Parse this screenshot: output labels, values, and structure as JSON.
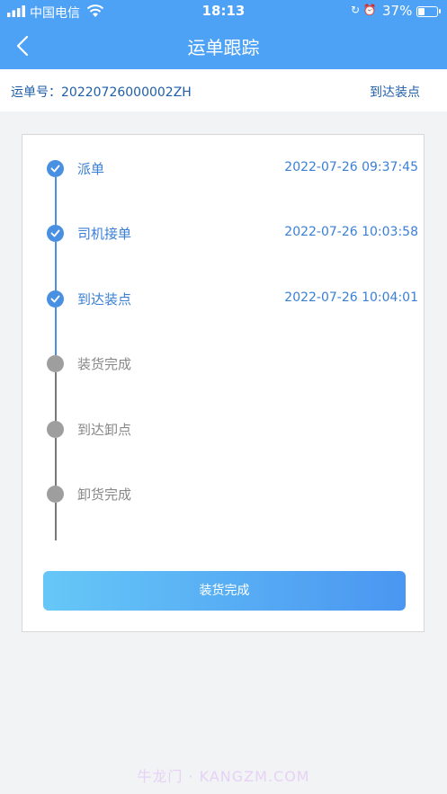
{
  "status_bar": {
    "carrier": "中国电信",
    "time": "18:13",
    "battery_pct": "37%",
    "battery_level": 0.37,
    "icons": [
      "signal-icon",
      "wifi-icon",
      "orientation-lock-icon",
      "alarm-icon",
      "battery-icon"
    ]
  },
  "nav": {
    "title": "运单跟踪",
    "back_icon": "chevron-left-icon"
  },
  "order": {
    "label": "运单号：20220726000002ZH",
    "status": "到达装点"
  },
  "steps": [
    {
      "label": "派单",
      "time": "2022-07-26 09:37:45",
      "done": true
    },
    {
      "label": "司机接单",
      "time": "2022-07-26 10:03:58",
      "done": true
    },
    {
      "label": "到达装点",
      "time": "2022-07-26 10:04:01",
      "done": true
    },
    {
      "label": "装货完成",
      "time": "",
      "done": false
    },
    {
      "label": "到达卸点",
      "time": "",
      "done": false
    },
    {
      "label": "卸货完成",
      "time": "",
      "done": false
    }
  ],
  "action_button": {
    "label": "装货完成"
  },
  "watermark": "牛龙门 · KANGZM.COM",
  "colors": {
    "primary": "#4da2f5",
    "done": "#4a90e2",
    "pending": "#9e9e9e",
    "done_text": "#3a7fd6",
    "pending_text": "#888888"
  }
}
